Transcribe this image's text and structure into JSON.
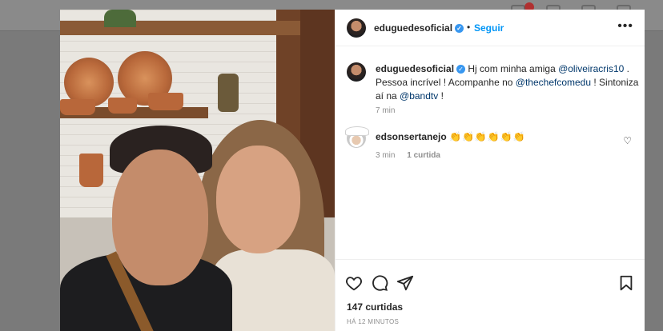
{
  "post": {
    "username": "eduguedesoficial",
    "follow_label": "Seguir",
    "more_label": "•••"
  },
  "caption": {
    "username": "eduguedesoficial",
    "text_1": " Hj com minha amiga ",
    "mention_1": "@oliveiracris10",
    "text_2": " . Pessoa incrível ! Acompanhe no ",
    "mention_2": "@thechefcomedu",
    "text_3": " ! Sintoniza aí na ",
    "mention_3": "@bandtv",
    "text_4": " !",
    "time": "7 min"
  },
  "comment": {
    "username": "edsonsertanejo",
    "emojis": "👏👏👏👏👏👏",
    "time": "3 min",
    "likes": "1 curtida"
  },
  "footer": {
    "likes_count": "147 curtidas",
    "post_time": "HÁ 12 MINUTOS"
  },
  "colors": {
    "accent": "#0095f6",
    "verified": "#3897f0",
    "text": "#262626",
    "muted": "#8e8e8e"
  }
}
